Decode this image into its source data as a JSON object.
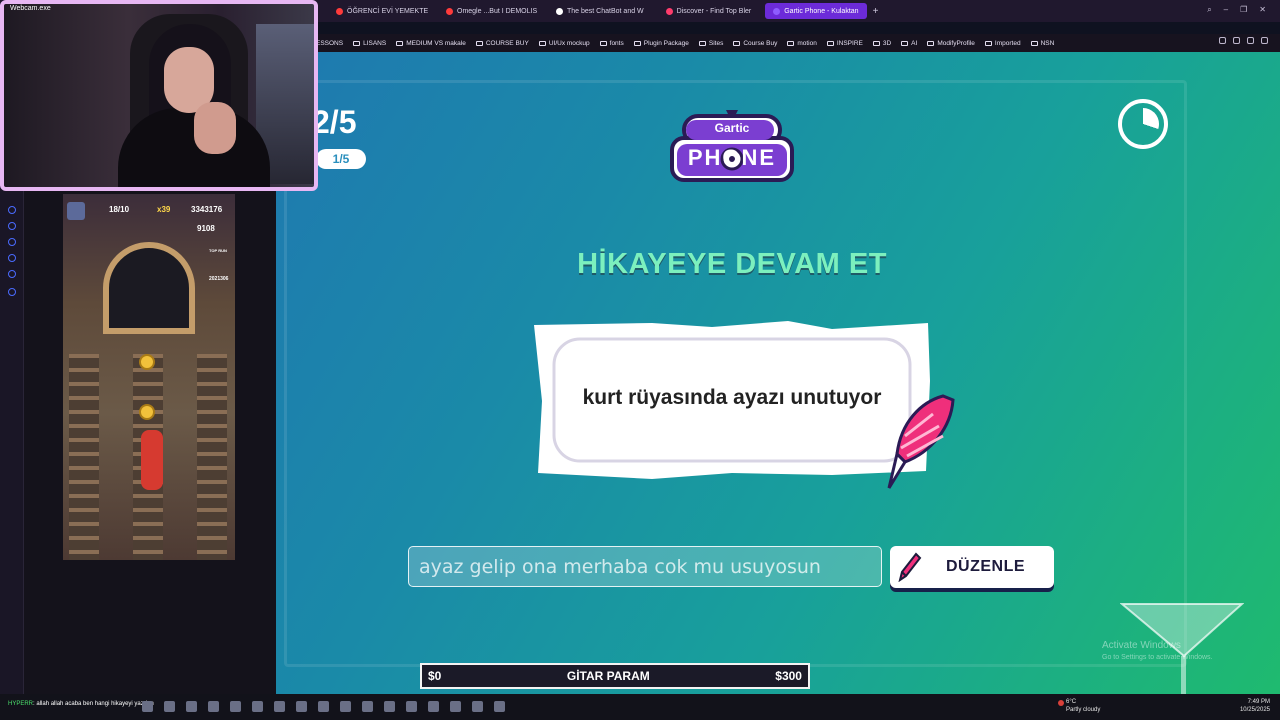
{
  "browser": {
    "tabs": [
      {
        "label": "ÖĞRENCİ EVİ YEMEKTE",
        "color": "#ff3b3b",
        "active": false
      },
      {
        "label": "Omegle ...But I DEMOLIS",
        "color": "#ff3b3b",
        "active": false
      },
      {
        "label": "The best ChatBot and W",
        "color": "#ffffff",
        "active": false
      },
      {
        "label": "Discover - Find Top Bler",
        "color": "#ff3c6c",
        "active": false
      },
      {
        "label": "Gartic Phone - Kulaktan",
        "color": "#8e5cff",
        "active": true
      }
    ],
    "new_tab": "+",
    "bookmarks": [
      "ESSONS",
      "LISANS",
      "MEDIUM VS makale",
      "COURSE BUY",
      "UI/Ux mockup",
      "fonts",
      "Plugin Package",
      "Sites",
      "Course Buy",
      "motion",
      "INSPIRE",
      "3D",
      "AI",
      "ModifyProfile",
      "Imported",
      "NSN"
    ]
  },
  "webcam": {
    "label": "Webcam.exe"
  },
  "mobile_game": {
    "time": "18/10",
    "multiplier": "x39",
    "score": "3343176",
    "coins": "9108",
    "rank": "TOP RUN",
    "rank_score": "2021306"
  },
  "game": {
    "round_big": "2/5",
    "round_pill": "1/5",
    "logo_line1": "Gartic",
    "logo_line2": "PHONE",
    "title": "HİKAYEYE DEVAM ET",
    "story_text": "kurt rüyasında ayazı unutuyor",
    "input_value": "ayaz gelip ona merhaba cok mu usuyosun",
    "edit_button": "DÜZENLE",
    "timer_fraction": 0.3
  },
  "goal_bar": {
    "left": "$0",
    "label": "GİTAR PARAM",
    "right": "$300"
  },
  "watermark": {
    "line1": "Activate Windows",
    "line2": "Go to Settings to activate Windows."
  },
  "taskbar": {
    "chat_user": "HYPERR",
    "chat_msg": "allah allah acaba ben hangi hikayeyi yazdım",
    "weather_temp": "6°C",
    "weather_desc": "Partly cloudy",
    "time": "7:49 PM",
    "date": "10/25/2025"
  }
}
